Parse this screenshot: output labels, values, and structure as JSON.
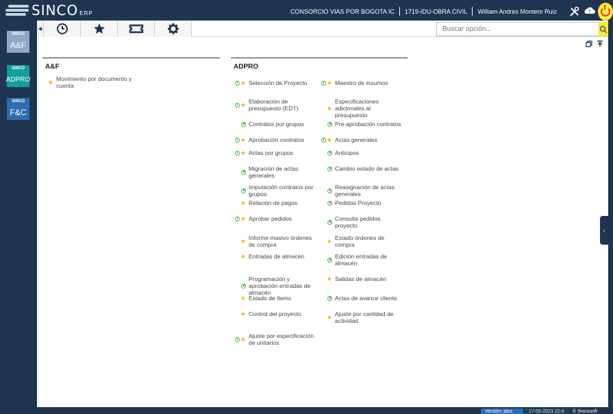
{
  "brand": {
    "name": "SINCO",
    "suffix": "ERP"
  },
  "header": {
    "company": "CONSORCIO VIAS POR BOGOTA IC",
    "project": "1719-IDU-OBRA CIVIL",
    "user": "William Andres Montero Ruiz"
  },
  "top_icons": [
    "tools-icon",
    "help-icon",
    "power-icon"
  ],
  "modules": [
    {
      "top": "SINCO",
      "label": "A&F"
    },
    {
      "top": "SINCO",
      "label": "ADPRO"
    },
    {
      "top": "SINCO",
      "label": "F&C"
    }
  ],
  "toolbar": {
    "buttons": [
      "history-icon",
      "favorites-icon",
      "ticket-icon",
      "settings-icon"
    ],
    "search_placeholder": "Buscar opción..."
  },
  "columns": {
    "af": {
      "title": "A&F",
      "items": [
        {
          "label": "Movimiento por documento y cuenta",
          "clock": false,
          "star": true
        }
      ]
    },
    "adpro": {
      "title": "ADPRO",
      "left": [
        {
          "label": "Selección de Proyecto",
          "clock": true,
          "star": true
        },
        {
          "label": "Elaboración de presupuesto (EDT)",
          "clock": true,
          "star": true
        },
        {
          "label": "Contratos por grupos",
          "clock": true,
          "star": false
        },
        {
          "label": "Aprobación contratos",
          "clock": true,
          "star": true
        },
        {
          "label": "Actas por grupos",
          "clock": true,
          "star": true
        },
        {
          "label": "Migración de actas generales",
          "clock": true,
          "star": false
        },
        {
          "label": "Imputación contratos por grupos",
          "clock": true,
          "star": false
        },
        {
          "label": "Relación de pagos",
          "clock": false,
          "star": true
        },
        {
          "label": "Aprobar pedidos",
          "clock": true,
          "star": true
        },
        {
          "label": "Informe masivo órdenes de compra",
          "clock": false,
          "star": true
        },
        {
          "label": "Entradas de almacén",
          "clock": false,
          "star": true
        },
        {
          "label": "Programación y aprobación entradas de almacén",
          "clock": true,
          "star": false
        },
        {
          "label": "Estado de ítems",
          "clock": false,
          "star": true
        },
        {
          "label": "Control del proyecto",
          "clock": false,
          "star": true
        },
        {
          "label": "Ajuste por especificación de unitarios",
          "clock": true,
          "star": true
        }
      ],
      "right": [
        {
          "label": "Maestro de insumos",
          "clock": true,
          "star": true
        },
        {
          "label": "Especificaciones adicionales al presupuesto",
          "clock": false,
          "star": true
        },
        {
          "label": "Pre-aprobación contratos",
          "clock": true,
          "star": false
        },
        {
          "label": "Actas generales",
          "clock": true,
          "star": true
        },
        {
          "label": "Anticipos",
          "clock": true,
          "star": false
        },
        {
          "label": "Cambio estado de actas",
          "clock": true,
          "star": false
        },
        {
          "label": "Reasignación de actas generales",
          "clock": true,
          "star": false
        },
        {
          "label": "Pedidos Proyecto",
          "clock": true,
          "star": false
        },
        {
          "label": "Consulta pedidos proyecto",
          "clock": true,
          "star": false
        },
        {
          "label": "Estado órdenes de compra",
          "clock": false,
          "star": true
        },
        {
          "label": "Edición entradas de almacén",
          "clock": true,
          "star": false
        },
        {
          "label": "Salidas de almacén",
          "clock": false,
          "star": true
        },
        {
          "label": "Actas de avance cliente",
          "clock": true,
          "star": false
        },
        {
          "label": "Ajuste por cantidad de actividad",
          "clock": false,
          "star": true
        }
      ]
    }
  },
  "status": {
    "version": "Versión: plus",
    "date": "17-05-2023 22:4",
    "copyright": "© Sincosoft"
  }
}
